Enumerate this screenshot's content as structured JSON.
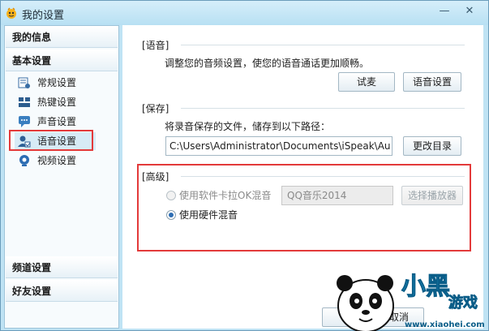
{
  "window": {
    "title": "我的设置"
  },
  "sidebar": {
    "categories": {
      "my_info": "我的信息",
      "basic": "基本设置",
      "channel": "频道设置",
      "friends": "好友设置"
    },
    "items": [
      {
        "label": "常规设置",
        "icon": "general-settings-icon"
      },
      {
        "label": "热键设置",
        "icon": "hotkey-icon"
      },
      {
        "label": "声音设置",
        "icon": "sound-icon"
      },
      {
        "label": "语音设置",
        "icon": "voice-icon",
        "active": true
      },
      {
        "label": "视频设置",
        "icon": "video-icon"
      }
    ]
  },
  "voice": {
    "section_label": "[语音]",
    "description": "调整您的音频设置，使您的语音通话更加顺畅。",
    "test_mic_label": "试麦",
    "voice_settings_label": "语音设置"
  },
  "save": {
    "section_label": "[保存]",
    "description": "将录音保存的文件，储存到以下路径：",
    "path_value": "C:\\Users\\Administrator\\Documents\\iSpeak\\Au",
    "change_dir_label": "更改目录"
  },
  "advanced": {
    "section_label": "[高级]",
    "software_mix_label": "使用软件卡拉OK混音",
    "player_value": "QQ音乐2014",
    "choose_player_label": "选择播放器",
    "hardware_mix_label": "使用硬件混音"
  },
  "footer": {
    "cancel_label": "取消"
  },
  "watermark": {
    "text": "小黑游戏",
    "url": "www.xiaohei.com"
  },
  "colors": {
    "accent": "#2d6db3",
    "highlight_red": "#e33a3a",
    "title_bg": "#bfe3f4"
  }
}
